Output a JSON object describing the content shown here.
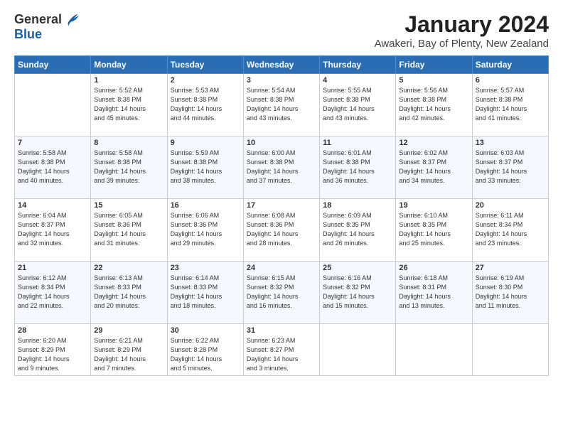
{
  "logo": {
    "general": "General",
    "blue": "Blue"
  },
  "title": "January 2024",
  "subtitle": "Awakeri, Bay of Plenty, New Zealand",
  "days": [
    "Sunday",
    "Monday",
    "Tuesday",
    "Wednesday",
    "Thursday",
    "Friday",
    "Saturday"
  ],
  "weeks": [
    [
      {
        "num": "",
        "info": ""
      },
      {
        "num": "1",
        "info": "Sunrise: 5:52 AM\nSunset: 8:38 PM\nDaylight: 14 hours\nand 45 minutes."
      },
      {
        "num": "2",
        "info": "Sunrise: 5:53 AM\nSunset: 8:38 PM\nDaylight: 14 hours\nand 44 minutes."
      },
      {
        "num": "3",
        "info": "Sunrise: 5:54 AM\nSunset: 8:38 PM\nDaylight: 14 hours\nand 43 minutes."
      },
      {
        "num": "4",
        "info": "Sunrise: 5:55 AM\nSunset: 8:38 PM\nDaylight: 14 hours\nand 43 minutes."
      },
      {
        "num": "5",
        "info": "Sunrise: 5:56 AM\nSunset: 8:38 PM\nDaylight: 14 hours\nand 42 minutes."
      },
      {
        "num": "6",
        "info": "Sunrise: 5:57 AM\nSunset: 8:38 PM\nDaylight: 14 hours\nand 41 minutes."
      }
    ],
    [
      {
        "num": "7",
        "info": "Sunrise: 5:58 AM\nSunset: 8:38 PM\nDaylight: 14 hours\nand 40 minutes."
      },
      {
        "num": "8",
        "info": "Sunrise: 5:58 AM\nSunset: 8:38 PM\nDaylight: 14 hours\nand 39 minutes."
      },
      {
        "num": "9",
        "info": "Sunrise: 5:59 AM\nSunset: 8:38 PM\nDaylight: 14 hours\nand 38 minutes."
      },
      {
        "num": "10",
        "info": "Sunrise: 6:00 AM\nSunset: 8:38 PM\nDaylight: 14 hours\nand 37 minutes."
      },
      {
        "num": "11",
        "info": "Sunrise: 6:01 AM\nSunset: 8:38 PM\nDaylight: 14 hours\nand 36 minutes."
      },
      {
        "num": "12",
        "info": "Sunrise: 6:02 AM\nSunset: 8:37 PM\nDaylight: 14 hours\nand 34 minutes."
      },
      {
        "num": "13",
        "info": "Sunrise: 6:03 AM\nSunset: 8:37 PM\nDaylight: 14 hours\nand 33 minutes."
      }
    ],
    [
      {
        "num": "14",
        "info": "Sunrise: 6:04 AM\nSunset: 8:37 PM\nDaylight: 14 hours\nand 32 minutes."
      },
      {
        "num": "15",
        "info": "Sunrise: 6:05 AM\nSunset: 8:36 PM\nDaylight: 14 hours\nand 31 minutes."
      },
      {
        "num": "16",
        "info": "Sunrise: 6:06 AM\nSunset: 8:36 PM\nDaylight: 14 hours\nand 29 minutes."
      },
      {
        "num": "17",
        "info": "Sunrise: 6:08 AM\nSunset: 8:36 PM\nDaylight: 14 hours\nand 28 minutes."
      },
      {
        "num": "18",
        "info": "Sunrise: 6:09 AM\nSunset: 8:35 PM\nDaylight: 14 hours\nand 26 minutes."
      },
      {
        "num": "19",
        "info": "Sunrise: 6:10 AM\nSunset: 8:35 PM\nDaylight: 14 hours\nand 25 minutes."
      },
      {
        "num": "20",
        "info": "Sunrise: 6:11 AM\nSunset: 8:34 PM\nDaylight: 14 hours\nand 23 minutes."
      }
    ],
    [
      {
        "num": "21",
        "info": "Sunrise: 6:12 AM\nSunset: 8:34 PM\nDaylight: 14 hours\nand 22 minutes."
      },
      {
        "num": "22",
        "info": "Sunrise: 6:13 AM\nSunset: 8:33 PM\nDaylight: 14 hours\nand 20 minutes."
      },
      {
        "num": "23",
        "info": "Sunrise: 6:14 AM\nSunset: 8:33 PM\nDaylight: 14 hours\nand 18 minutes."
      },
      {
        "num": "24",
        "info": "Sunrise: 6:15 AM\nSunset: 8:32 PM\nDaylight: 14 hours\nand 16 minutes."
      },
      {
        "num": "25",
        "info": "Sunrise: 6:16 AM\nSunset: 8:32 PM\nDaylight: 14 hours\nand 15 minutes."
      },
      {
        "num": "26",
        "info": "Sunrise: 6:18 AM\nSunset: 8:31 PM\nDaylight: 14 hours\nand 13 minutes."
      },
      {
        "num": "27",
        "info": "Sunrise: 6:19 AM\nSunset: 8:30 PM\nDaylight: 14 hours\nand 11 minutes."
      }
    ],
    [
      {
        "num": "28",
        "info": "Sunrise: 6:20 AM\nSunset: 8:29 PM\nDaylight: 14 hours\nand 9 minutes."
      },
      {
        "num": "29",
        "info": "Sunrise: 6:21 AM\nSunset: 8:29 PM\nDaylight: 14 hours\nand 7 minutes."
      },
      {
        "num": "30",
        "info": "Sunrise: 6:22 AM\nSunset: 8:28 PM\nDaylight: 14 hours\nand 5 minutes."
      },
      {
        "num": "31",
        "info": "Sunrise: 6:23 AM\nSunset: 8:27 PM\nDaylight: 14 hours\nand 3 minutes."
      },
      {
        "num": "",
        "info": ""
      },
      {
        "num": "",
        "info": ""
      },
      {
        "num": "",
        "info": ""
      }
    ]
  ]
}
